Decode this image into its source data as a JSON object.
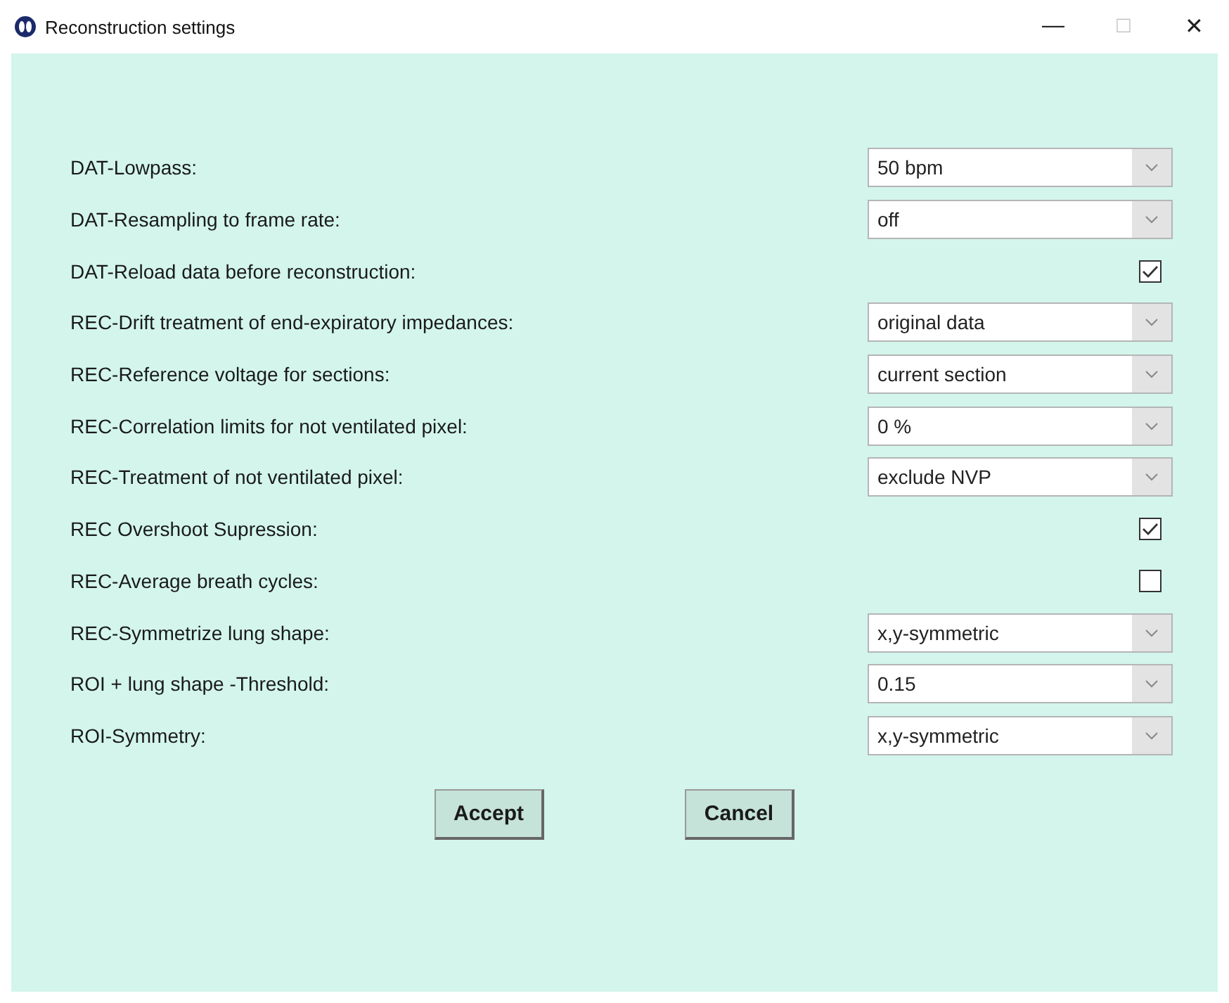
{
  "window": {
    "title": "Reconstruction settings",
    "controls": [
      "—",
      "□",
      "✕"
    ]
  },
  "settings": [
    {
      "label": "DAT-Lowpass:",
      "kind": "select",
      "value": "50 bpm"
    },
    {
      "label": "DAT-Resampling to frame rate:",
      "kind": "select",
      "value": "off"
    },
    {
      "label": "DAT-Reload data before reconstruction:",
      "kind": "checkbox",
      "checked": true
    },
    {
      "label": "REC-Drift treatment of end-expiratory impedances:",
      "kind": "select",
      "value": "original data"
    },
    {
      "label": "REC-Reference voltage for sections:",
      "kind": "select",
      "value": "current section"
    },
    {
      "label": "REC-Correlation limits for not ventilated pixel:",
      "kind": "select",
      "value": "0 %"
    },
    {
      "label": "REC-Treatment of not ventilated pixel:",
      "kind": "select",
      "value": "exclude NVP"
    },
    {
      "label": "REC Overshoot Supression:",
      "kind": "checkbox",
      "checked": true
    },
    {
      "label": "REC-Average breath cycles:",
      "kind": "checkbox",
      "checked": false
    },
    {
      "label": "REC-Symmetrize lung shape:",
      "kind": "select",
      "value": "x,y-symmetric"
    },
    {
      "label": "ROI + lung shape -Threshold:",
      "kind": "select",
      "value": "0.15"
    },
    {
      "label": "ROI-Symmetry:",
      "kind": "select",
      "value": "x,y-symmetric"
    }
  ],
  "buttons": [
    "Accept",
    "Cancel"
  ]
}
